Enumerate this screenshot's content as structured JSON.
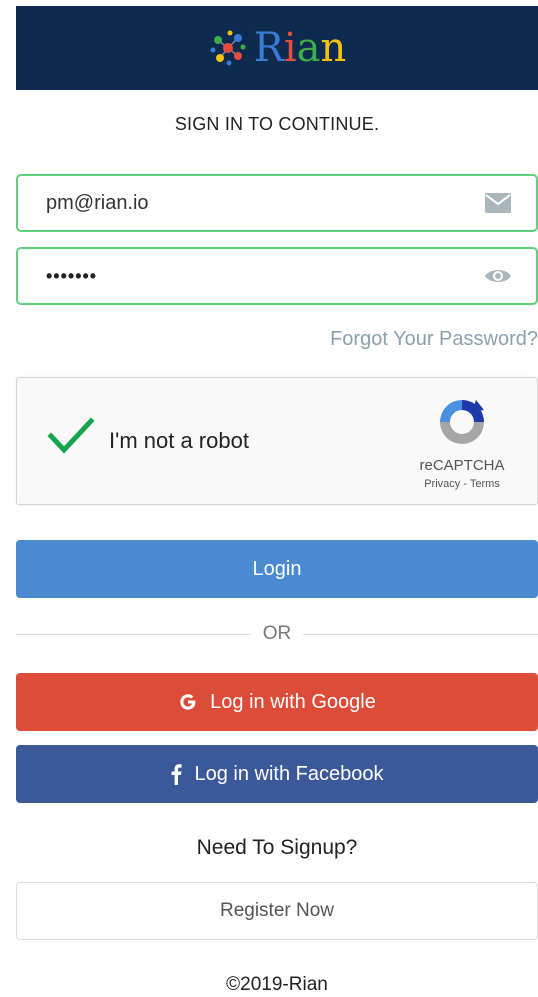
{
  "header": {
    "brand": "Rian",
    "brand_letters": [
      "R",
      "i",
      "a",
      "n"
    ]
  },
  "signin": {
    "title": "SIGN IN TO CONTINUE."
  },
  "email_field": {
    "value": "pm@rian.io",
    "icon": "envelope-icon"
  },
  "password_field": {
    "masked_value": "•••••••",
    "icon": "eye-icon"
  },
  "forgot_password": {
    "label": "Forgot Your Password?"
  },
  "recaptcha": {
    "label": "I'm not a robot",
    "brand": "reCAPTCHA",
    "links": "Privacy - Terms",
    "checked": true
  },
  "login_button": {
    "label": "Login"
  },
  "divider": {
    "label": "OR"
  },
  "google_button": {
    "label": "Log in with Google",
    "icon": "google-icon"
  },
  "facebook_button": {
    "label": "Log in with Facebook",
    "icon": "facebook-icon"
  },
  "signup": {
    "question": "Need To Signup?",
    "register_label": "Register Now"
  },
  "footer": {
    "copyright": "©2019-Rian"
  },
  "colors": {
    "header_bg": "#0f2a4f",
    "field_border": "#5fd07b",
    "login_bg": "#4a8ad0",
    "google_bg": "#dd4b39",
    "facebook_bg": "#3b5998",
    "link": "#8aa1ad"
  }
}
